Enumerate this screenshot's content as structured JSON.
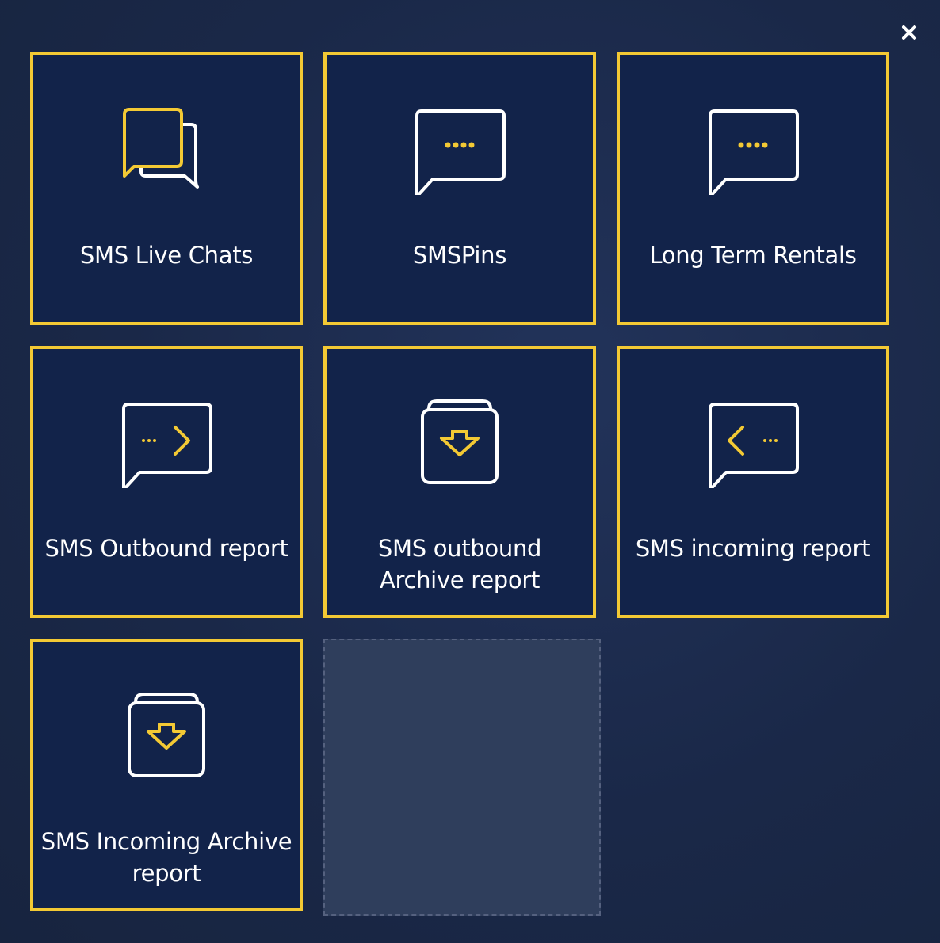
{
  "dialog": {
    "close_icon": "close-icon",
    "colors": {
      "background": "#1b2a4b",
      "tile_background": "#12234a",
      "tile_border": "#f3c934",
      "accent": "#f3c934",
      "text": "#ffffff",
      "placeholder": "#2f3e5c"
    }
  },
  "tiles": [
    {
      "label": "SMS Live Chats",
      "icon": "chat-bubbles-icon"
    },
    {
      "label": "SMSPins",
      "icon": "chat-dots-icon"
    },
    {
      "label": "Long Term Rentals",
      "icon": "chat-dots-icon"
    },
    {
      "label": "SMS Outbound report",
      "icon": "chat-outbound-icon"
    },
    {
      "label": "SMS outbound Archive report",
      "icon": "archive-download-icon"
    },
    {
      "label": "SMS incoming report",
      "icon": "chat-incoming-icon"
    },
    {
      "label": "SMS Incoming Archive report",
      "icon": "archive-download-icon"
    }
  ],
  "empty_slot": "tile-placeholder"
}
